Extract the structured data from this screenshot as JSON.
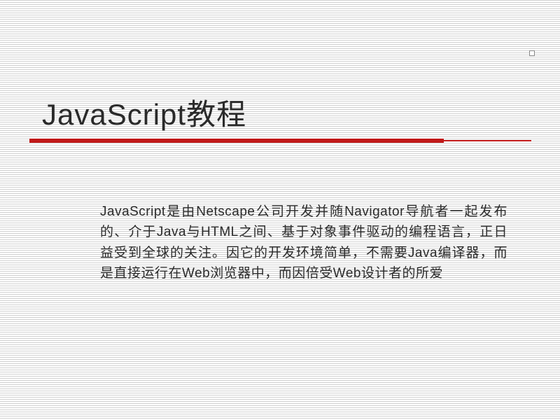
{
  "slide": {
    "title": "JavaScript教程",
    "body": "JavaScript是由Netscape公司开发并随Navigator导航者一起发布的、介于Java与HTML之间、基于对象事件驱动的编程语言，正日益受到全球的关注。因它的开发环境简单，不需要Java编译器，而是直接运行在Web浏览器中，而因倍受Web设计者的所爱"
  }
}
